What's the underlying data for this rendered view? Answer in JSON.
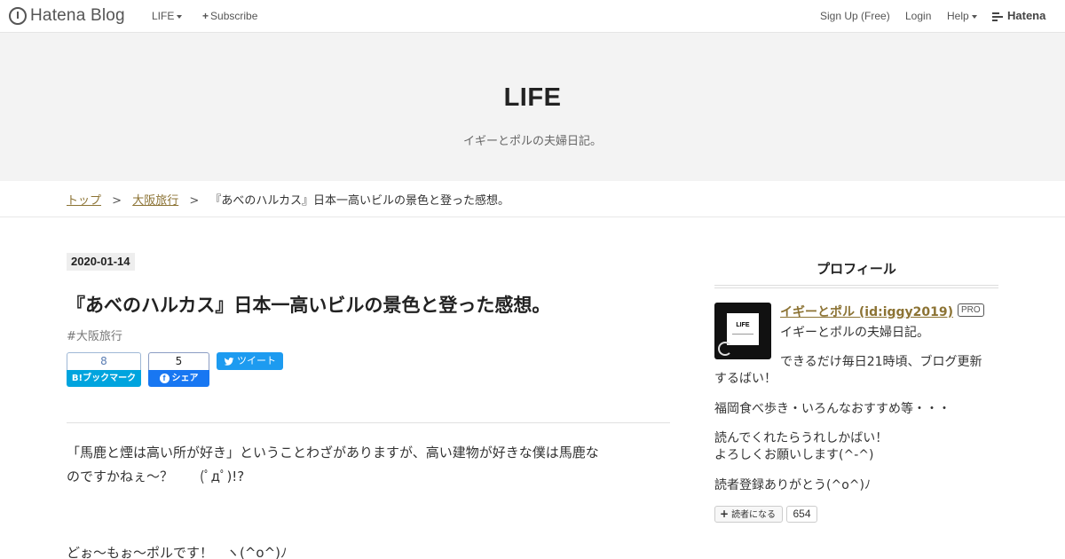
{
  "topnav": {
    "logo_text": "Hatena Blog",
    "blog_menu_label": "LIFE",
    "subscribe_label": "Subscribe",
    "signup_label": "Sign Up (Free)",
    "login_label": "Login",
    "help_label": "Help",
    "brand_label": "Hatena"
  },
  "header": {
    "title": "LIFE",
    "description": "イギーとポルの夫婦日記。"
  },
  "breadcrumb": {
    "items": [
      "トップ",
      "大阪旅行"
    ],
    "separator": ">",
    "current": "『あべのハルカス』日本一高いビルの景色と登った感想。"
  },
  "entry": {
    "date": "2020-01-14",
    "title": "『あべのハルカス』日本一高いビルの景色と登った感想。",
    "category": "#大阪旅行",
    "share": {
      "bookmark_count": "8",
      "bookmark_label": "B!ブックマーク",
      "facebook_count": "5",
      "facebook_label": "シェア",
      "tweet_label": "ツイート"
    },
    "paragraphs": [
      "「馬鹿と煙は高い所が好き」ということわざがありますが、高い建物が好きな僕は馬鹿な",
      "のですかねぇ～？　　(ﾟдﾟ)!?",
      "どぉ～もぉ～ポルです！　ヽ(^o^)ﾉ"
    ]
  },
  "sidebar": {
    "heading": "プロフィール",
    "avatar_text": "LIFE",
    "profile_name": "イギーとポル (id:iggy2019)",
    "pro_badge": "PRO",
    "bio": [
      "イギーとポルの夫婦日記。",
      "できるだけ毎日21時頃、ブログ更新",
      "するばい！",
      "福岡食べ歩き・いろんなおすすめ等・・・",
      "読んでくれたらうれしかばい！",
      "よろしくお願いします(^-^)",
      "読者登録ありがとう(^o^)ﾉ"
    ],
    "reader_button_label": "読者になる",
    "reader_count": "654"
  },
  "colors": {
    "link": "#8c7334",
    "header_bg": "#f3f3f3",
    "bookmark_blue": "#00a4de",
    "facebook_blue": "#1877f2",
    "twitter_blue": "#1d9bf0"
  }
}
